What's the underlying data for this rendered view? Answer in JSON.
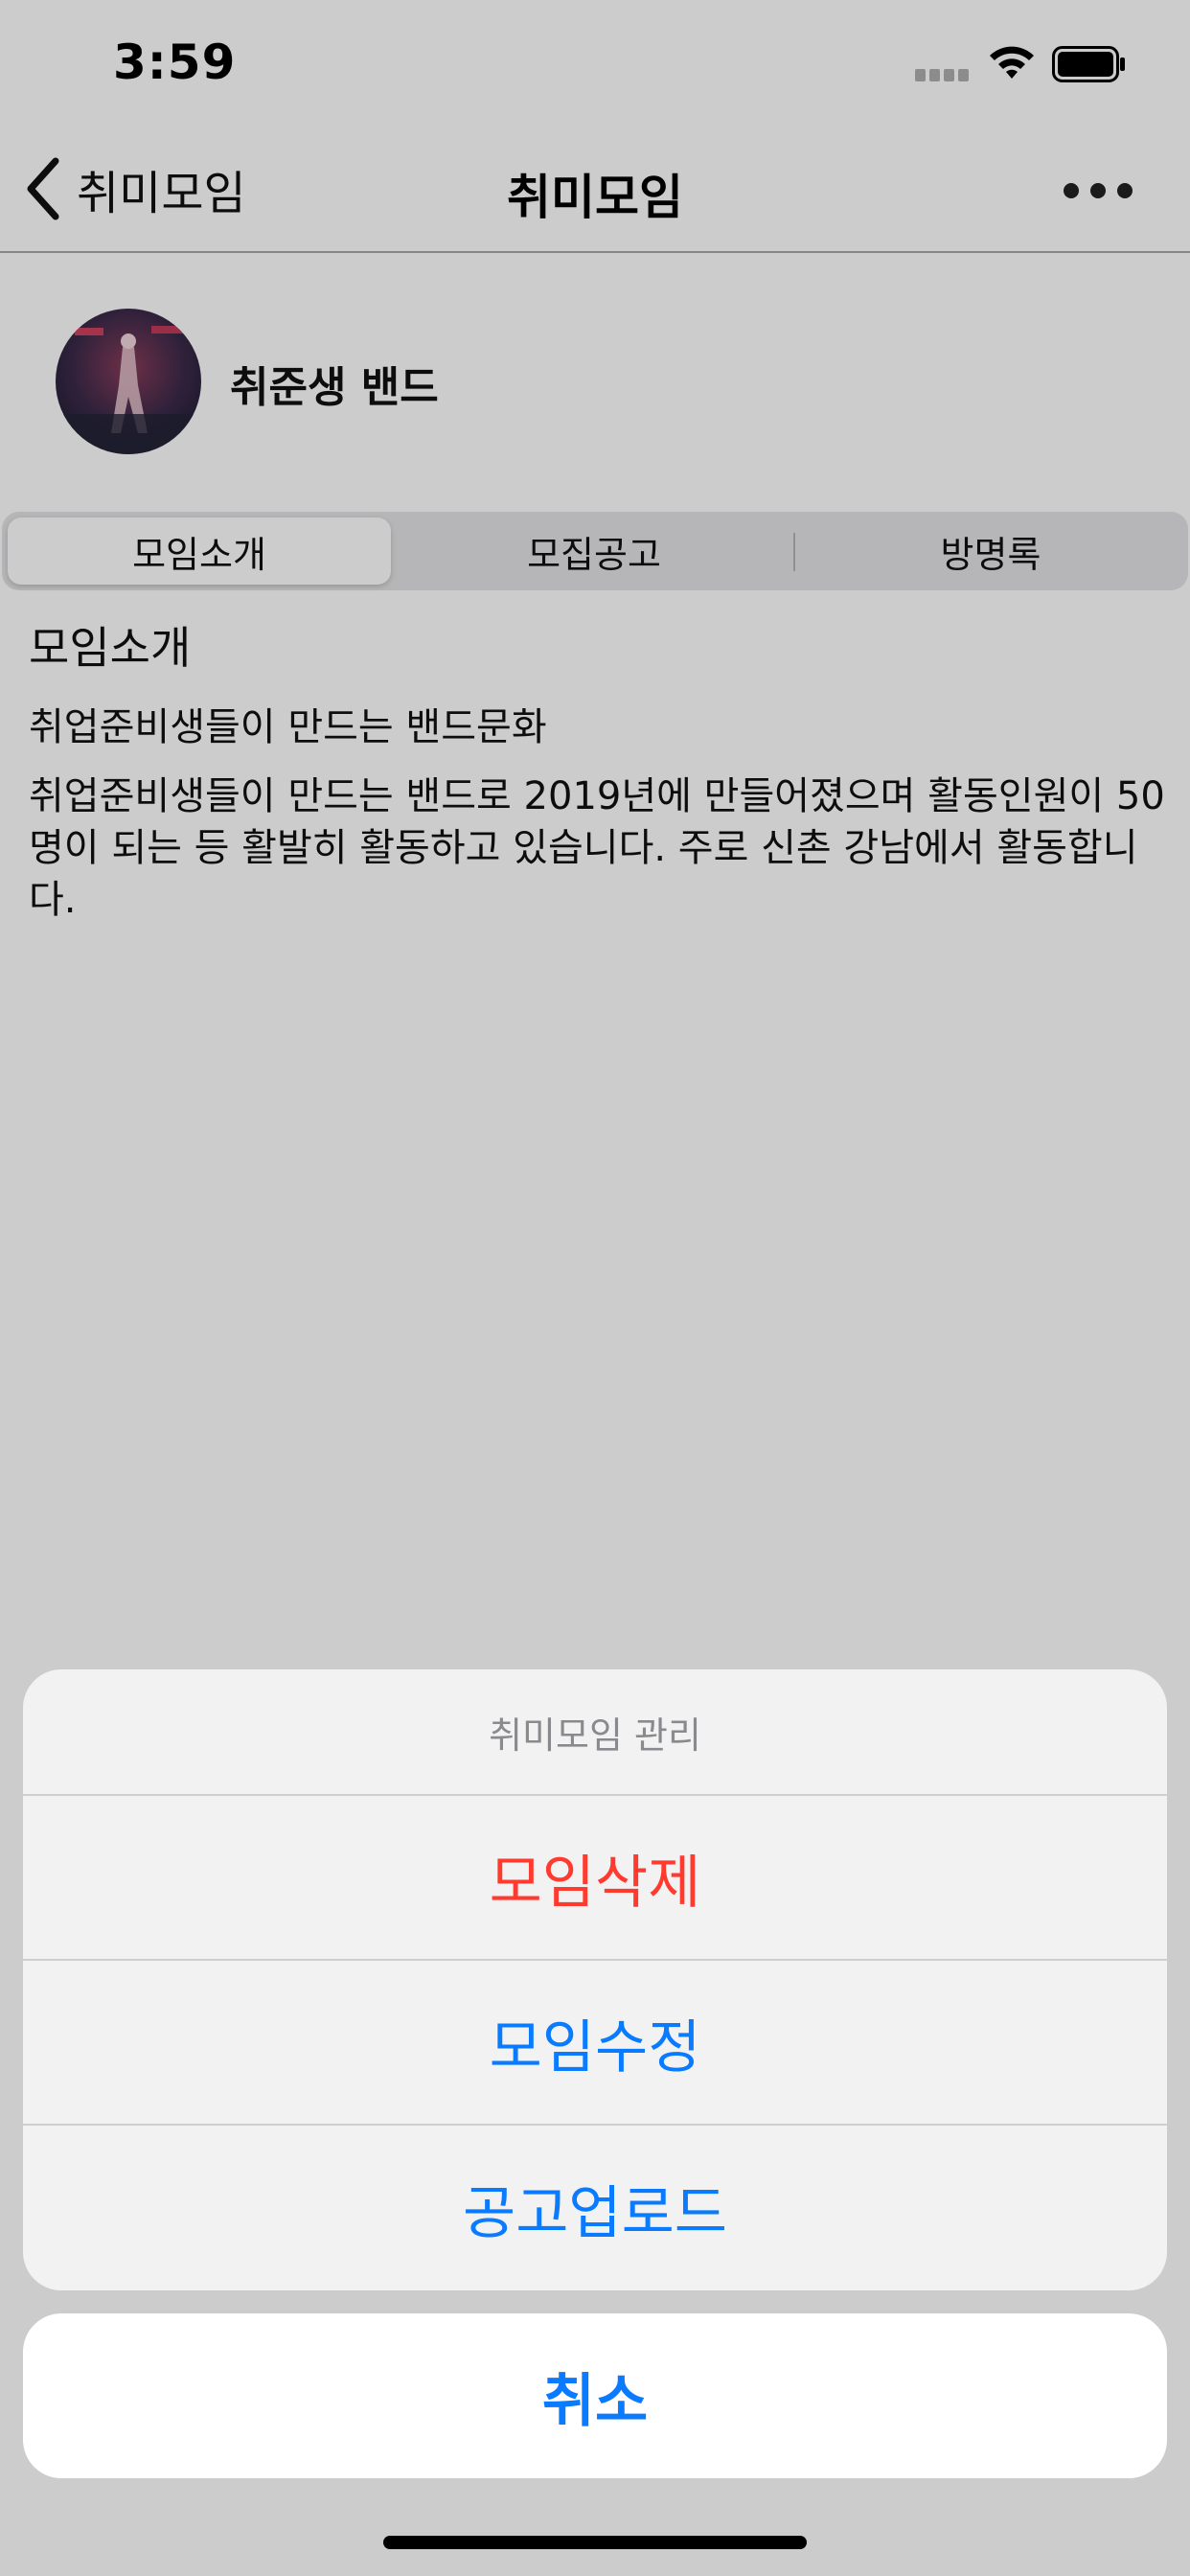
{
  "status_bar": {
    "time": "3:59",
    "signal_icon": "cellular-signal-icon",
    "wifi_icon": "wifi-icon",
    "battery_icon": "battery-icon"
  },
  "nav": {
    "back_label": "취미모임",
    "title": "취미모임",
    "more_icon": "ellipsis-icon"
  },
  "group": {
    "name": "취준생 밴드"
  },
  "tabs": [
    {
      "label": "모임소개",
      "selected": true
    },
    {
      "label": "모집공고",
      "selected": false
    },
    {
      "label": "방명록",
      "selected": false
    }
  ],
  "intro": {
    "title": "모임소개",
    "summary": "취업준비생들이 만드는 밴드문화",
    "body": "취업준비생들이 만드는 밴드로 2019년에 만들어졌으며 활동인원이 50명이 되는 등 활발히 활동하고 있습니다. 주로 신촌 강남에서 활동합니다."
  },
  "action_sheet": {
    "title": "취미모임 관리",
    "actions": [
      {
        "label": "모임삭제",
        "style": "destructive"
      },
      {
        "label": "모임수정",
        "style": "default"
      },
      {
        "label": "공고업로드",
        "style": "default"
      }
    ],
    "cancel_label": "취소"
  },
  "colors": {
    "accent": "#0a7bff",
    "destructive": "#ff3b30"
  }
}
